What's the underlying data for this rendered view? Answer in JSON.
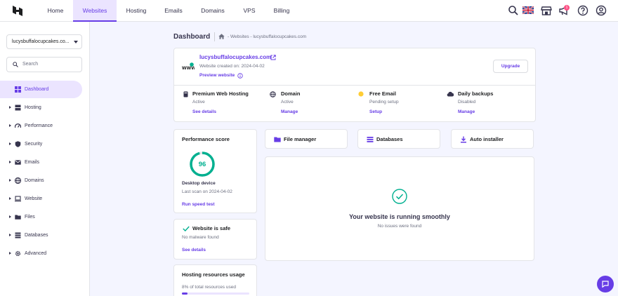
{
  "topnav": {
    "items": [
      {
        "label": "Home"
      },
      {
        "label": "Websites"
      },
      {
        "label": "Hosting"
      },
      {
        "label": "Emails"
      },
      {
        "label": "Domains"
      },
      {
        "label": "VPS"
      },
      {
        "label": "Billing"
      }
    ],
    "active": "Websites",
    "notification_count": "1"
  },
  "sidebar": {
    "site_select_value": "lucysbuffalocupcakes.co...",
    "search_placeholder": "Search",
    "items": [
      {
        "label": "Dashboard",
        "icon": "grid-icon"
      },
      {
        "label": "Hosting",
        "icon": "server-icon"
      },
      {
        "label": "Performance",
        "icon": "speedometer-icon"
      },
      {
        "label": "Security",
        "icon": "shield-icon"
      },
      {
        "label": "Emails",
        "icon": "envelope-icon"
      },
      {
        "label": "Domains",
        "icon": "globe-icon"
      },
      {
        "label": "Website",
        "icon": "laptop-icon"
      },
      {
        "label": "Files",
        "icon": "folder-icon"
      },
      {
        "label": "Databases",
        "icon": "database-icon"
      },
      {
        "label": "Advanced",
        "icon": "gear-icon"
      }
    ]
  },
  "breadcrumb": {
    "title": "Dashboard",
    "path": "- Websites - lucysbuffalocupcakes.com"
  },
  "site_card": {
    "domain": "lucysbuffalocupcakes.com",
    "created": "Website created on: 2024-04-02",
    "preview": "Preview website",
    "upgrade": "Upgrade",
    "features": [
      {
        "title": "Premium Web Hosting",
        "status": "Active",
        "action": "See details"
      },
      {
        "title": "Domain",
        "status": "Active",
        "action": "Manage"
      },
      {
        "title": "Free Email",
        "status": "Pending setup",
        "action": "Setup"
      },
      {
        "title": "Daily backups",
        "status": "Disabled",
        "action": "Manage"
      }
    ]
  },
  "performance": {
    "title": "Performance score",
    "score": "96",
    "score_value": 96,
    "device": "Desktop device",
    "last_scan": "Last scan on 2024-04-02",
    "action": "Run speed test"
  },
  "safety": {
    "title": "Website is safe",
    "subtitle": "No malware found",
    "action": "See details"
  },
  "resources": {
    "title": "Hosting resources usage",
    "usage_text": "8% of total resources used",
    "usage_percent": 8
  },
  "quick_actions": [
    {
      "label": "File manager",
      "icon": "folder-icon"
    },
    {
      "label": "Databases",
      "icon": "database-icon"
    },
    {
      "label": "Auto installer",
      "icon": "download-icon"
    }
  ],
  "status_panel": {
    "title": "Your website is running smoothly",
    "subtitle": "No issues were found"
  },
  "colors": {
    "accent": "#673de6",
    "success": "#00b090",
    "warning": "#ffcd35"
  }
}
